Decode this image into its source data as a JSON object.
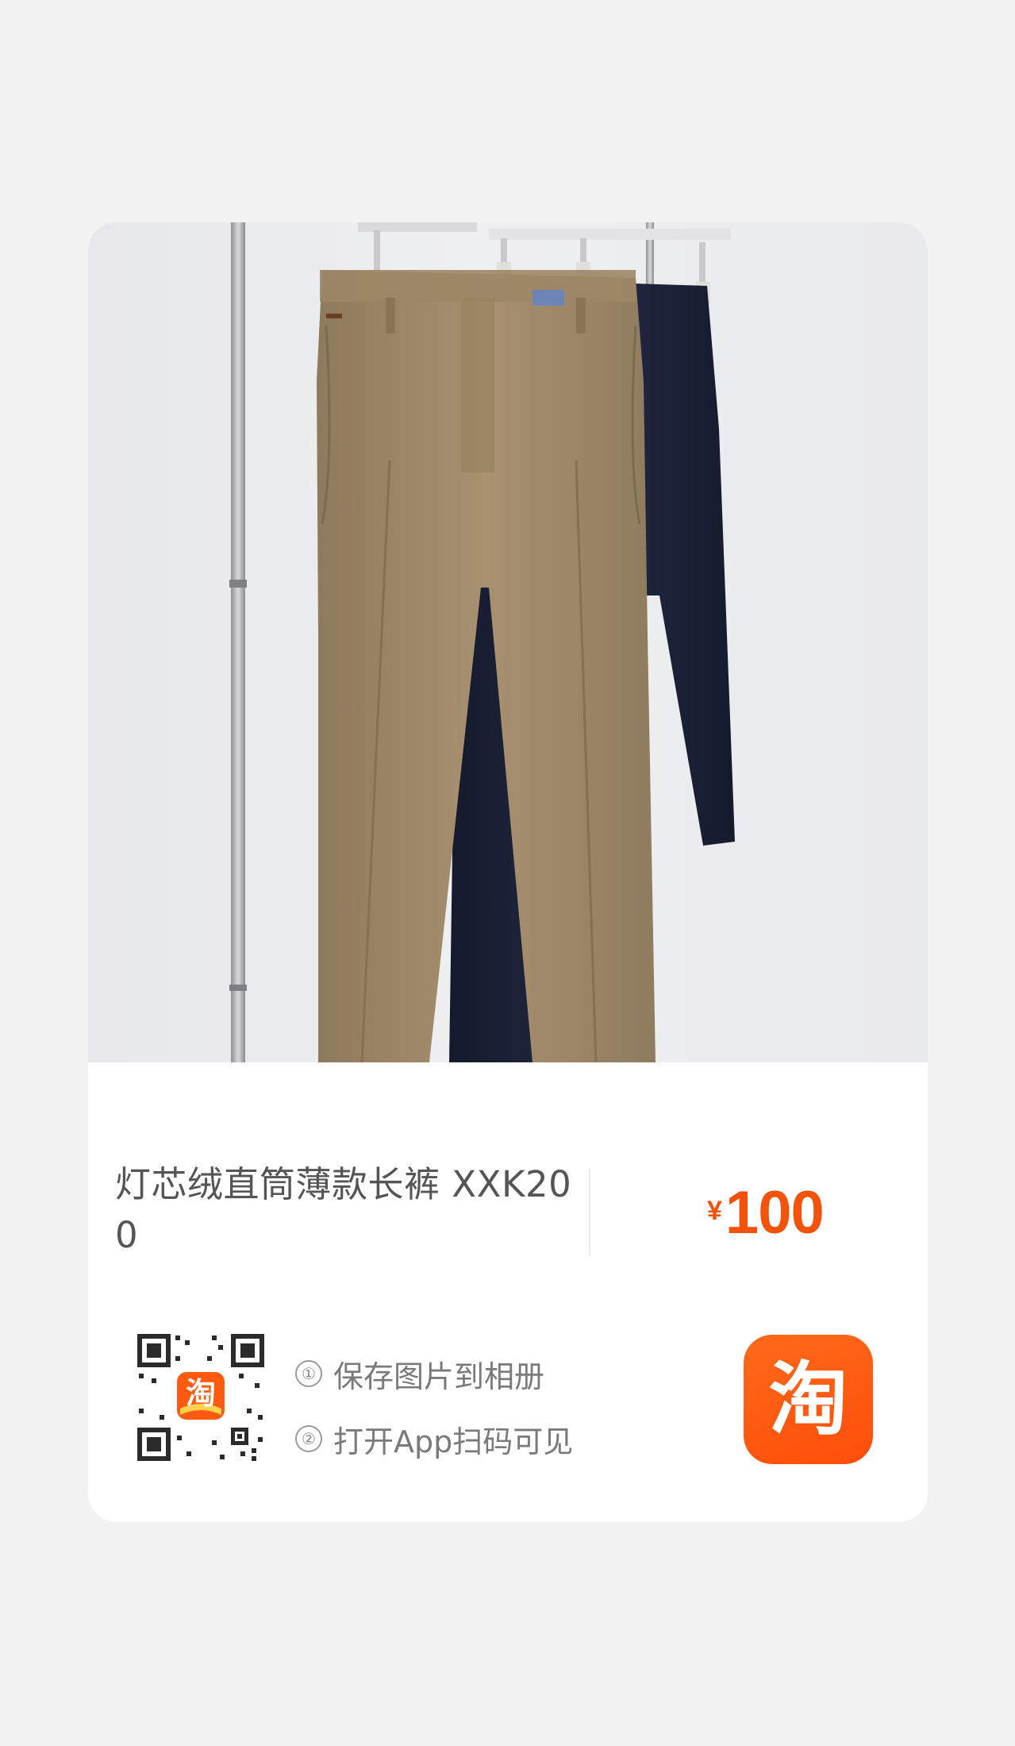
{
  "product": {
    "title": "灯芯绒直筒薄款长裤 XXK200",
    "price_currency": "¥",
    "price_amount": "100",
    "image_alt": "Two pairs of corduroy straight pants on hangers: khaki in front, navy behind"
  },
  "share": {
    "step1_num": "①",
    "step1_text": "保存图片到相册",
    "step2_num": "②",
    "step2_text": "打开App扫码可见",
    "app_icon_glyph": "淘",
    "qr_logo_glyph": "淘"
  },
  "colors": {
    "accent": "#f2520a",
    "app_icon": "#ff5a0f",
    "khaki_pants": "#a08a6a",
    "navy_pants": "#1c2238"
  }
}
